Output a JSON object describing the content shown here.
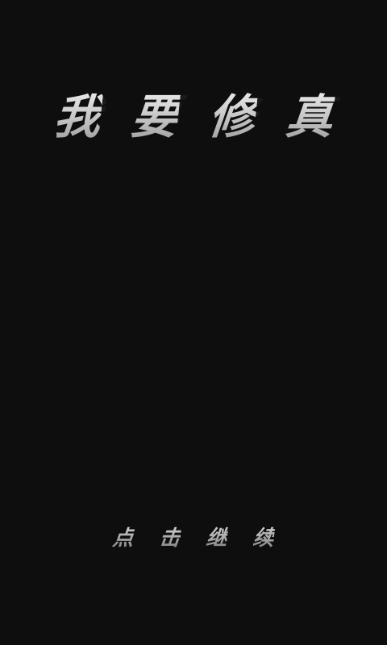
{
  "title": {
    "chars": [
      "我",
      "要",
      "修",
      "真"
    ]
  },
  "continue_prompt": {
    "chars": [
      "点",
      "击",
      "继",
      "续"
    ]
  },
  "colors": {
    "background": "#0e0e0e",
    "text_light": "#f2f2f2",
    "text_dark": "#8f8f8f"
  }
}
